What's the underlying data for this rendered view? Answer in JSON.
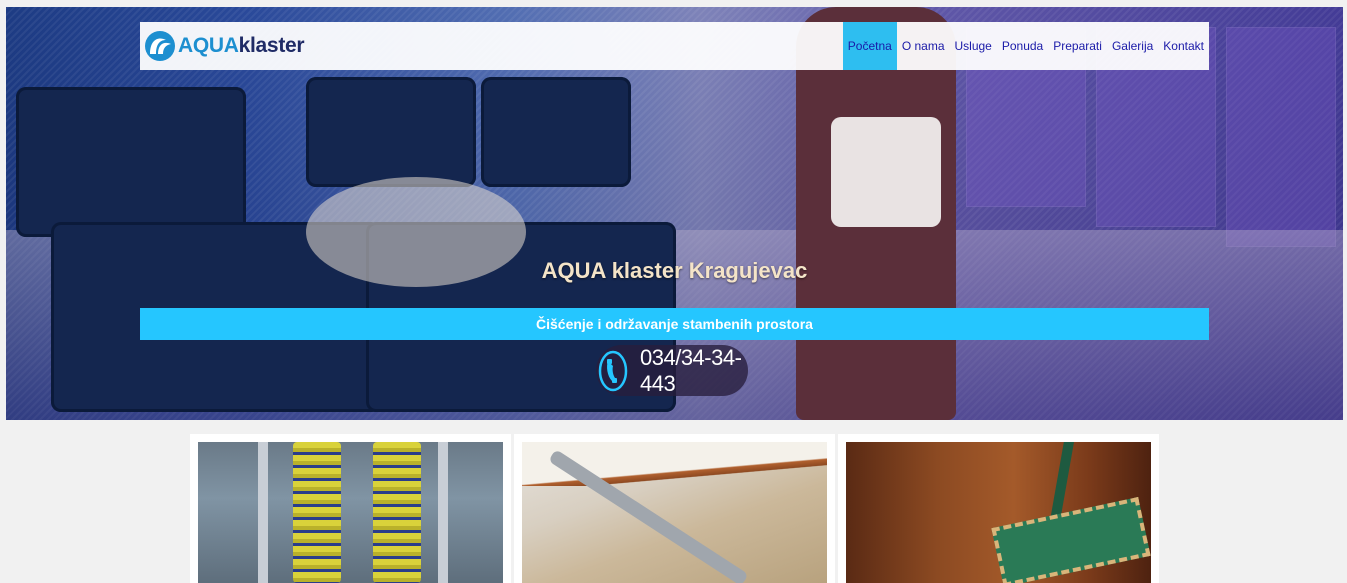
{
  "brand": {
    "aqua": "AQUA",
    "klaster": "klaster"
  },
  "nav": {
    "items": [
      {
        "label": "Početna",
        "active": true
      },
      {
        "label": "O nama",
        "active": false
      },
      {
        "label": "Usluge",
        "active": false
      },
      {
        "label": "Ponuda",
        "active": false
      },
      {
        "label": "Preparati",
        "active": false
      },
      {
        "label": "Galerija",
        "active": false
      },
      {
        "label": "Kontakt",
        "active": false
      }
    ]
  },
  "hero": {
    "title": "AQUA klaster Kragujevac",
    "subtitle": "Čišćenje i održavanje stambenih prostora",
    "phone": "034/34-34-443",
    "phone_icon": "phone-icon"
  },
  "cards": [
    {
      "image": "car-wash-brushes"
    },
    {
      "image": "carpet-cleaning-wand"
    },
    {
      "image": "floor-mop"
    }
  ],
  "colors": {
    "accent": "#25c6ff",
    "nav_active": "#2ebef0",
    "nav_link": "#1a1aa8",
    "title": "#f4e4c8"
  }
}
